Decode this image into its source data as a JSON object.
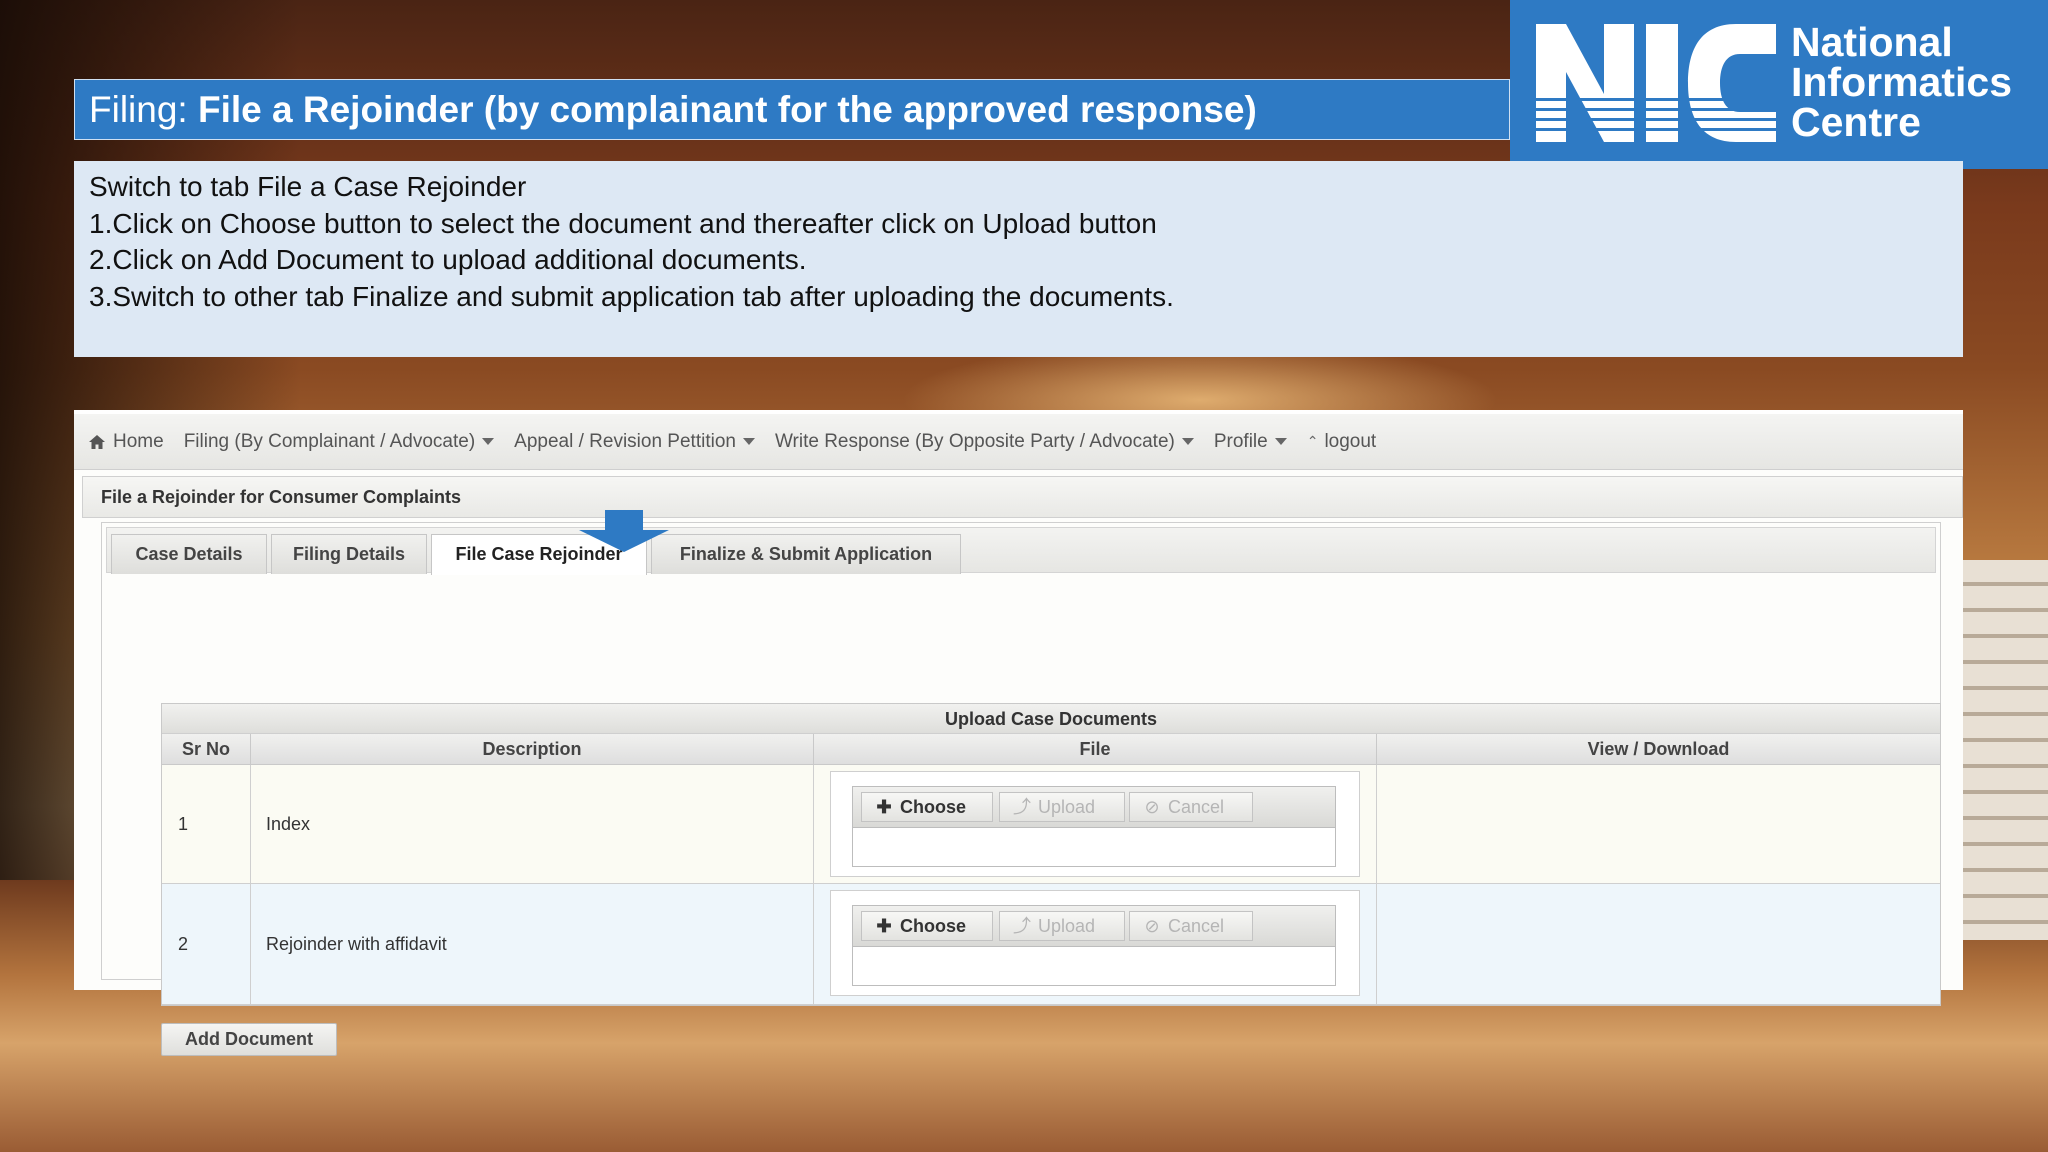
{
  "title": {
    "prefix": "Filing: ",
    "main": "File a Rejoinder (by complainant for the approved response)"
  },
  "logo": {
    "mark": "NIC",
    "line1": "National",
    "line2": "Informatics",
    "line3": "Centre",
    "color": "#2e7ac4"
  },
  "instructions": [
    "Switch to tab File a Case Rejoinder",
    "1.Click on Choose button to select the document and thereafter click on Upload button",
    "2.Click on Add Document to upload additional documents.",
    "3.Switch to other tab Finalize and submit application tab after uploading the documents."
  ],
  "navbar": {
    "home_icon": "home-icon",
    "items": [
      {
        "label": "Home"
      },
      {
        "label": "Filing (By Complainant / Advocate)"
      },
      {
        "label": "Appeal / Revision Pettition"
      },
      {
        "label": "Write Response (By Opposite Party / Advocate)"
      },
      {
        "label": "Profile"
      },
      {
        "label": "logout"
      }
    ]
  },
  "page_header": "File a Rejoinder for Consumer Complaints",
  "tabs": [
    {
      "label": "Case Details",
      "active": false
    },
    {
      "label": "Filing Details",
      "active": false
    },
    {
      "label": "File Case Rejoinder",
      "active": true
    },
    {
      "label": "Finalize & Submit Application",
      "active": false
    }
  ],
  "documents": {
    "caption": "Upload Case Documents",
    "headers": [
      "Sr No",
      "Description",
      "File",
      "View / Download"
    ],
    "rows": [
      {
        "sr": "1",
        "description": "Index"
      },
      {
        "sr": "2",
        "description": "Rejoinder with affidavit"
      }
    ],
    "uploader": {
      "choose": "Choose",
      "upload": "Upload",
      "cancel": "Cancel"
    }
  },
  "add_document": "Add Document"
}
